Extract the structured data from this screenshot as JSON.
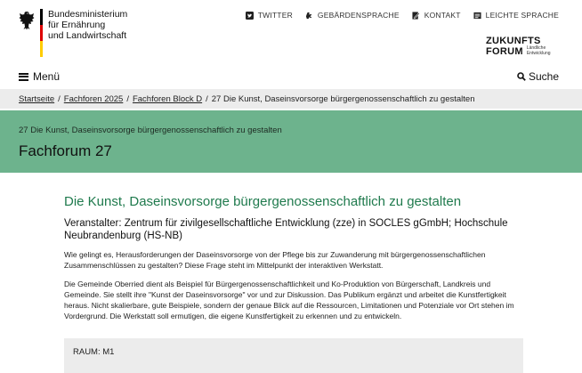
{
  "header": {
    "ministry_lines": [
      "Bundesministerium",
      "für Ernährung",
      "und Landwirtschaft"
    ],
    "flag_colors": [
      "#000000",
      "#dd0000",
      "#ffcc00"
    ],
    "top_nav": [
      {
        "label": "TWITTER",
        "icon": "twitter-icon"
      },
      {
        "label": "GEBÄRDENSPRACHE",
        "icon": "sign-language-icon"
      },
      {
        "label": "KONTAKT",
        "icon": "contact-icon"
      },
      {
        "label": "LEICHTE SPRACHE",
        "icon": "easy-language-icon"
      }
    ],
    "zukunft": {
      "line1": "ZUKUNFTS",
      "line2": "FORUM",
      "line3a": "Ländliche",
      "line3b": "Entwicklung"
    },
    "menu_label": "Menü",
    "search_label": "Suche"
  },
  "breadcrumb": {
    "items": [
      "Startseite",
      "Fachforen 2025",
      "Fachforen Block D"
    ],
    "current": "27 Die Kunst, Daseinsvorsorge bürgergenossenschaftlich zu gestalten",
    "separator": "/"
  },
  "hero": {
    "subtitle": "27 Die Kunst, Daseinsvorsorge bürgergenossenschaftlich zu gestalten",
    "title": "Fachforum 27",
    "bg_color": "#6db38d"
  },
  "content": {
    "heading": "Die Kunst, Daseinsvorsorge bürgergenossenschaftlich zu gestalten",
    "organizer": "Veranstalter: Zentrum für zivilgesellschaftliche Entwicklung (zze) in SOCLES gGmbH; Hochschule Neubrandenburg (HS-NB)",
    "paragraph1": "Wie gelingt es, Herausforderungen der Daseinsvorsorge von der Pflege bis zur Zuwanderung mit bürgergenossenschaftlichen Zusammenschlüssen zu gestalten? Diese Frage steht im Mittelpunkt der interaktiven Werkstatt.",
    "paragraph2": "Die Gemeinde Oberried dient als Beispiel für Bürgergenossenschaftlichkeit und Ko-Produktion von Bürgerschaft, Landkreis und Gemeinde. Sie stellt ihre \"Kunst der Daseinsvorsorge\" vor und zur Diskussion. Das Publikum ergänzt und arbeitet die Kunstfertigkeit heraus. Nicht skalierbare, gute Beispiele, sondern der genaue Blick auf die Ressourcen, Limitationen und Potenziale vor Ort stehen im Vordergrund. Die Werkstatt soll ermutigen, die eigene Kunstfertigkeit zu erkennen und zu entwickeln.",
    "heading_color": "#1f7a4d"
  },
  "raum": {
    "label": "RAUM: M1"
  }
}
